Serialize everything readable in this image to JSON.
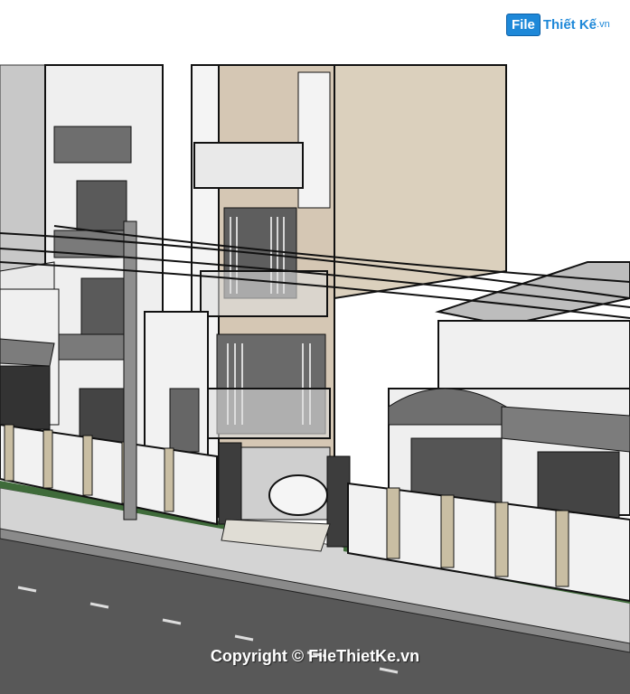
{
  "watermark": {
    "logo_box": "File",
    "logo_text": "Thiết Kế",
    "logo_domain": ".vn",
    "copyright": "Copyright © FileThietKe.vn"
  },
  "colors": {
    "sky": "#ffffff",
    "ground": "#d9d9d9",
    "road": "#5a5a5a",
    "wall_beige": "#d9cbb8",
    "wall_white": "#f2f2f2",
    "shadow_gray": "#a6a6a6",
    "accent_blue": "#1e88d8"
  }
}
